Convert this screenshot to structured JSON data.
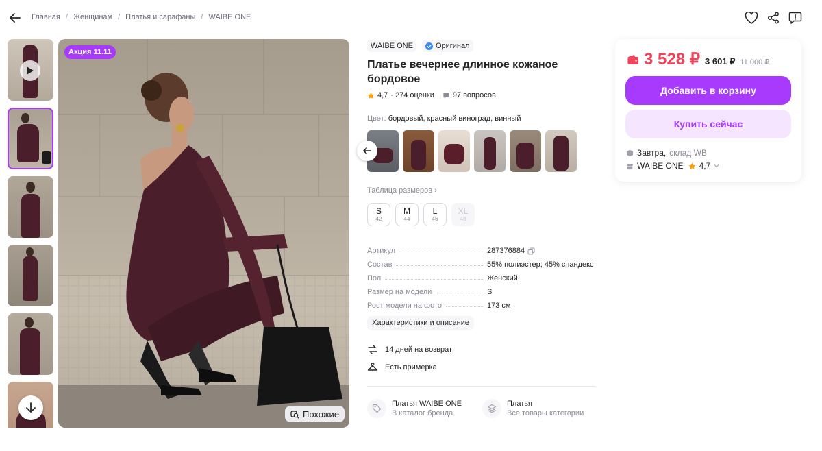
{
  "breadcrumbs": [
    "Главная",
    "Женщинам",
    "Платья и сарафаны",
    "WAIBE ONE"
  ],
  "media": {
    "promo_badge": "Акция 11.11",
    "similar_button": "Похожие"
  },
  "product": {
    "brand": "WAIBE ONE",
    "original_label": "Оригинал",
    "title": "Платье вечернее длинное кожаное бордовое",
    "rating": "4,7",
    "reviews": "· 274 оценки",
    "questions": "97 вопросов",
    "color_label": "Цвет:",
    "color_value": "бордовый, красный виноград, винный",
    "size_table_link": "Таблица размеров",
    "sizes": [
      {
        "size": "S",
        "ru": "42",
        "available": true
      },
      {
        "size": "M",
        "ru": "44",
        "available": true
      },
      {
        "size": "L",
        "ru": "46",
        "available": true
      },
      {
        "size": "XL",
        "ru": "48",
        "available": false
      }
    ],
    "specs": [
      {
        "key": "Артикул",
        "value": "287376884"
      },
      {
        "key": "Состав",
        "value": "55% полиэстер; 45% спандекс"
      },
      {
        "key": "Пол",
        "value": "Женский"
      },
      {
        "key": "Размер на модели",
        "value": "S"
      },
      {
        "key": "Рост модели на фото",
        "value": "173 см"
      }
    ],
    "characteristics_button": "Характеристики и описание",
    "perks": [
      "14 дней на возврат",
      "Есть примерка"
    ],
    "catalog_links": [
      {
        "title": "Платья WAIBE ONE",
        "sub": "В каталог бренда",
        "icon": "tag-icon"
      },
      {
        "title": "Платья",
        "sub": "Все товары категории",
        "icon": "layers-icon"
      }
    ]
  },
  "buy_card": {
    "price_wallet": "3 528 ₽",
    "price": "3 601 ₽",
    "price_old": "11 000 ₽",
    "add_to_cart": "Добавить в корзину",
    "buy_now": "Купить сейчас",
    "delivery_day": "Завтра,",
    "delivery_from": "склад WB",
    "seller_name": "WAIBE ONE",
    "seller_rating": "4,7"
  },
  "colors": {
    "accent": "#a73afd",
    "accent_light": "#f6e5ff",
    "price": "#f1435a",
    "star": "#ff9d00",
    "dress": "#4a1f2b"
  }
}
